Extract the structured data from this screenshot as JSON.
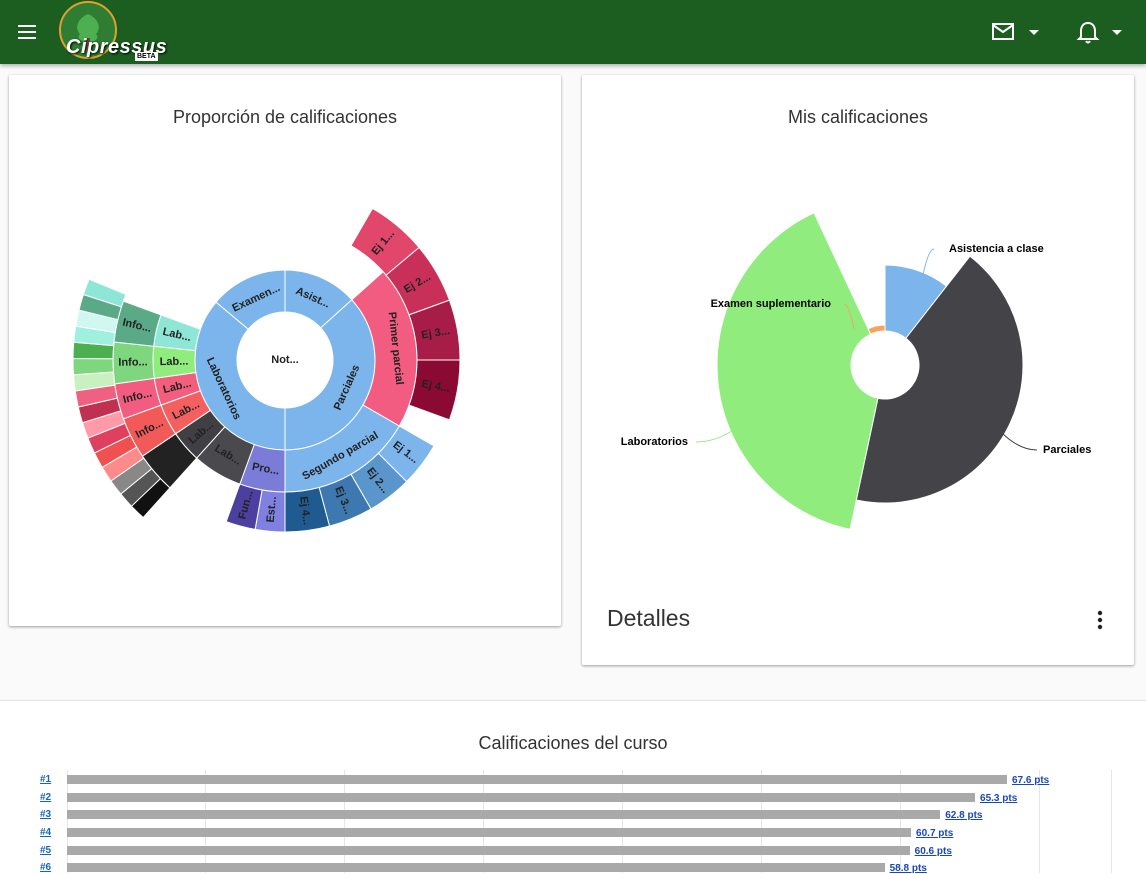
{
  "topbar": {
    "app_name": "Cipressus",
    "badge": "BETA",
    "mail_icon": "mail-icon",
    "bell_icon": "bell-icon",
    "menu_icon": "menu-icon"
  },
  "card_sunburst": {
    "title": "Proporción de calificaciones",
    "labels": {
      "root": "Not...",
      "examen": "Examen...",
      "asist": "Asist...",
      "parciales": "Parciales",
      "laboratorios": "Laboratorios",
      "primer": "Primer parcial",
      "segundo": "Segundo parcial",
      "p1": [
        "Ej 1...",
        "Ej 2...",
        "Ej 3...",
        "Ej 4..."
      ],
      "p2": [
        "Ej 1...",
        "Ej 2...",
        "Ej 3...",
        "Ej 4..."
      ],
      "pro": "Pro...",
      "fun": "Fun...",
      "est": "Est...",
      "lab": "Lab...",
      "info": "Info..."
    }
  },
  "card_pie": {
    "title": "Mis calificaciones",
    "slices": [
      {
        "label": "Asistencia a clase",
        "color": "#7cb5ec"
      },
      {
        "label": "Parciales",
        "color": "#434348"
      },
      {
        "label": "Laboratorios",
        "color": "#90ed7d"
      },
      {
        "label": "Examen suplementario",
        "color": "#f7a35c"
      }
    ],
    "details_label": "Detalles"
  },
  "bottom": {
    "title": "Calificaciones del curso"
  },
  "chart_data": [
    {
      "type": "bar",
      "title": "Calificaciones del curso",
      "categories": [
        "#1",
        "#2",
        "#3",
        "#4",
        "#5",
        "#6"
      ],
      "values": [
        67.6,
        65.3,
        62.8,
        60.7,
        60.6,
        58.8
      ],
      "value_labels": [
        "67.6 pts",
        "65.3 pts",
        "62.8 pts",
        "60.7 pts",
        "60.6 pts",
        "58.8 pts"
      ],
      "orientation": "horizontal"
    }
  ]
}
